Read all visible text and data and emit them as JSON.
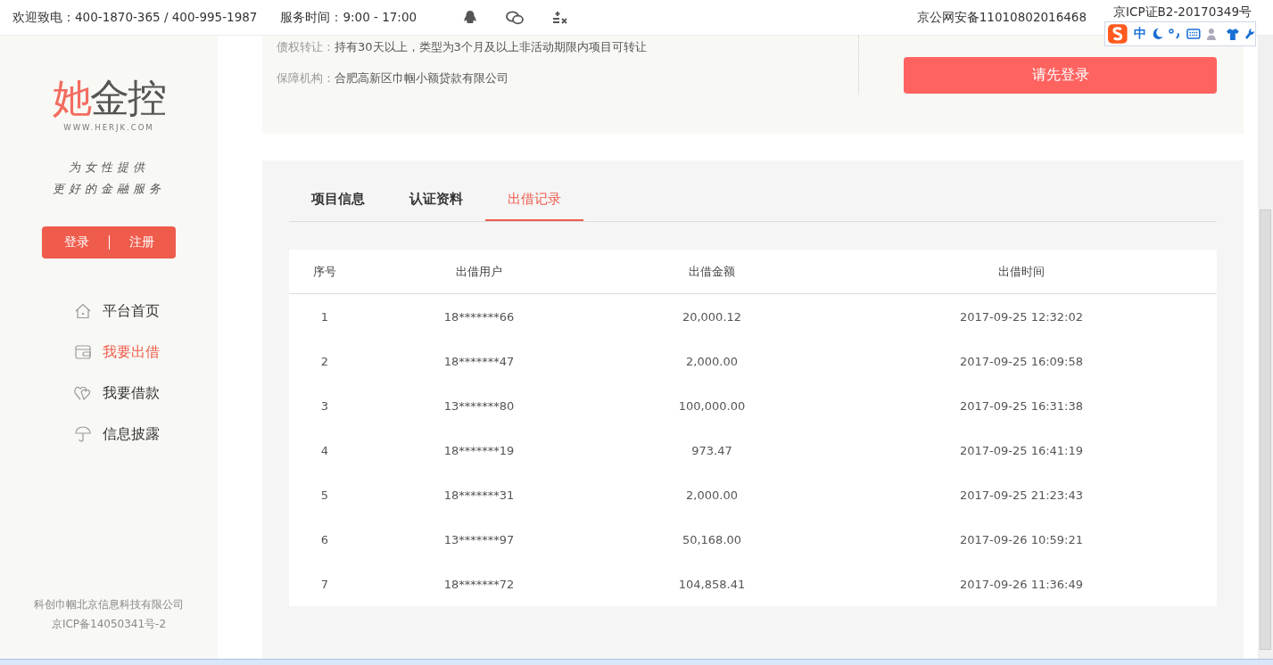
{
  "top_bar": {
    "hotline": "欢迎致电：400-1870-365 / 400-995-1987",
    "service_hours": "服务时间：9:00 - 17:00",
    "police_record": "京公网安备11010802016468",
    "icp_license": "京ICP证B2-20170349号"
  },
  "ime_toolbar": {
    "mode": "中"
  },
  "sidebar": {
    "logo": {
      "name_first": "她",
      "name_rest": "金控",
      "url": "WWW.HERJK.COM"
    },
    "slogan": [
      "为女性提供",
      "更好的金融服务"
    ],
    "auth": {
      "login": "登录",
      "register": "注册"
    },
    "items": [
      {
        "label": "平台首页",
        "selected": false
      },
      {
        "label": "我要出借",
        "selected": true
      },
      {
        "label": "我要借款",
        "selected": false
      },
      {
        "label": "信息披露",
        "selected": false
      }
    ],
    "footer": [
      "科创巾帼北京信息科技有限公司",
      "京ICP备14050341号-2"
    ]
  },
  "project_info": {
    "rows": [
      {
        "label": "债权转让：",
        "value": "持有30天以上，类型为3个月及以上非活动期限内项目可转让"
      },
      {
        "label": "保障机构：",
        "value": "合肥高新区巾帼小额贷款有限公司"
      }
    ],
    "action_button": "请先登录"
  },
  "tabs": [
    {
      "label": "项目信息",
      "selected": false
    },
    {
      "label": "认证资料",
      "selected": false
    },
    {
      "label": "出借记录",
      "selected": true
    }
  ],
  "table": {
    "columns": [
      "序号",
      "出借用户",
      "出借金额",
      "出借时间"
    ],
    "rows": [
      [
        "1",
        "18*******66",
        "20,000.12",
        "2017-09-25 12:32:02"
      ],
      [
        "2",
        "18*******47",
        "2,000.00",
        "2017-09-25 16:09:58"
      ],
      [
        "3",
        "13*******80",
        "100,000.00",
        "2017-09-25 16:31:38"
      ],
      [
        "4",
        "18*******19",
        "973.47",
        "2017-09-25 16:41:19"
      ],
      [
        "5",
        "18*******31",
        "2,000.00",
        "2017-09-25 21:23:43"
      ],
      [
        "6",
        "13*******97",
        "50,168.00",
        "2017-09-26 10:59:21"
      ],
      [
        "7",
        "18*******72",
        "104,858.41",
        "2017-09-26 11:36:49"
      ]
    ]
  }
}
